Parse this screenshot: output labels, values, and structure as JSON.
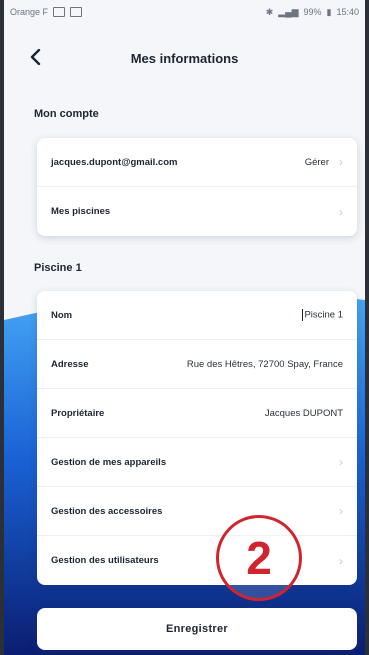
{
  "status_bar": {
    "carrier": "Orange F",
    "battery": "99%",
    "time": "15:40"
  },
  "header": {
    "title": "Mes informations"
  },
  "account": {
    "section_title": "Mon compte",
    "email": "jacques.dupont@gmail.com",
    "manage_label": "Gérer",
    "pools_label": "Mes piscines"
  },
  "pool": {
    "section_title": "Piscine 1",
    "rows": [
      {
        "label": "Nom",
        "value": "Piscine 1"
      },
      {
        "label": "Adresse",
        "value": "Rue des Hêtres, 72700 Spay, France"
      },
      {
        "label": "Propriétaire",
        "value": "Jacques DUPONT"
      },
      {
        "label": "Gestion de mes appareils",
        "value": ""
      },
      {
        "label": "Gestion des accessoires",
        "value": ""
      },
      {
        "label": "Gestion des utilisateurs",
        "value": ""
      }
    ]
  },
  "save_button": {
    "label": "Enregistrer"
  },
  "annotation": {
    "number": "2",
    "color": "#d0252f"
  },
  "colors": {
    "wave_top": "#2f8ff0",
    "wave_bottom": "#0a2d8f",
    "text_dark": "#1d2433"
  }
}
